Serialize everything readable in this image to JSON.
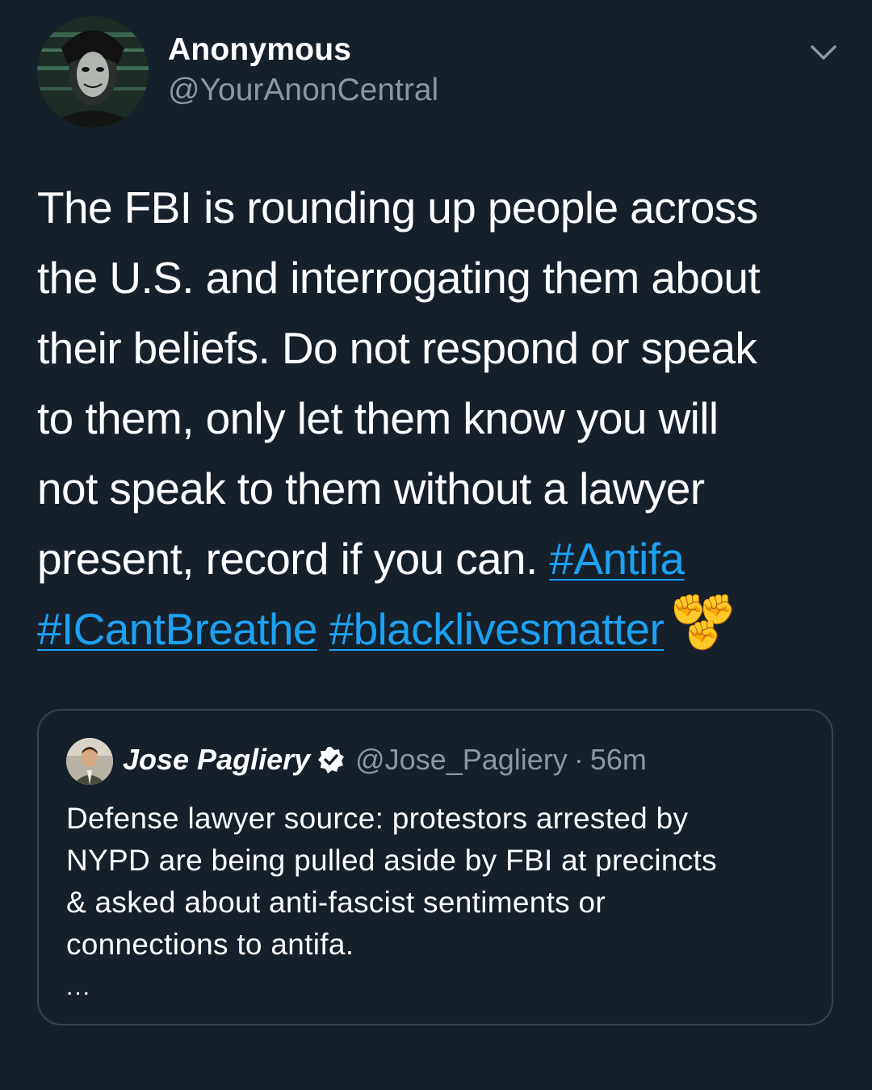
{
  "author": {
    "display_name": "Anonymous",
    "handle": "@YourAnonCentral"
  },
  "tweet": {
    "text_lines": [
      "The FBI is rounding up people across",
      "the U.S. and interrogating them about",
      "their beliefs. Do not respond or speak",
      "to them, only let them know you will",
      "not speak to them without a lawyer",
      "present, record if you can. "
    ],
    "hashtags": [
      "#Antifa",
      "#ICantBreathe",
      "#blacklivesmatter"
    ],
    "emoji": "✊🏾✊🏿✊🏼",
    "emoji_parts": [
      "✊",
      "✊",
      "✊"
    ]
  },
  "quoted_tweet": {
    "display_name": "Jose Pagliery",
    "handle": "@Jose_Pagliery",
    "separator": "·",
    "time": "56m",
    "text_lines": [
      "Defense lawyer source: protestors arrested by",
      "NYPD are being pulled aside by FBI at precincts",
      "& asked about anti-fascist sentiments or",
      "connections to antifa."
    ],
    "more": "..."
  },
  "icons": {
    "menu": "chevron-down-icon",
    "verified": "verified-badge-icon"
  },
  "colors": {
    "background": "#15202b",
    "link": "#1da1f2",
    "secondary_text": "#8899a6",
    "border": "#38444d"
  }
}
